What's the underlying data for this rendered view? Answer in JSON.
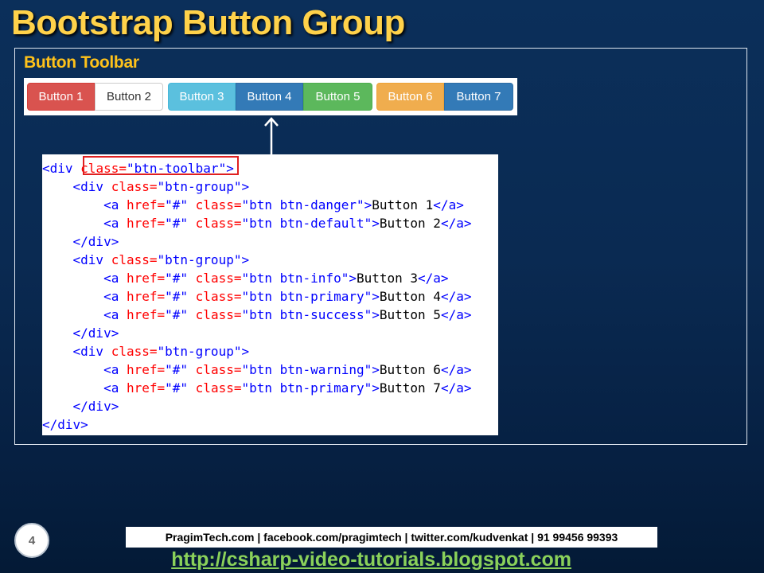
{
  "slide": {
    "title": "Bootstrap Button Group",
    "section_heading": "Button Toolbar",
    "page_number": "4"
  },
  "toolbar": {
    "groups": [
      [
        {
          "label": "Button 1",
          "style": "danger"
        },
        {
          "label": "Button 2",
          "style": "default"
        }
      ],
      [
        {
          "label": "Button 3",
          "style": "info"
        },
        {
          "label": "Button 4",
          "style": "primary"
        },
        {
          "label": "Button 5",
          "style": "success"
        }
      ],
      [
        {
          "label": "Button 6",
          "style": "warning"
        },
        {
          "label": "Button 7",
          "style": "primary"
        }
      ]
    ]
  },
  "code": {
    "lines": [
      [
        [
          "tag",
          "<div "
        ],
        [
          "attr",
          "class="
        ],
        [
          "val",
          "\"btn-toolbar\""
        ],
        [
          "tag",
          ">"
        ]
      ],
      [
        [
          "txt",
          "    "
        ],
        [
          "tag",
          "<div "
        ],
        [
          "attr",
          "class="
        ],
        [
          "val",
          "\"btn-group\""
        ],
        [
          "tag",
          ">"
        ]
      ],
      [
        [
          "txt",
          "        "
        ],
        [
          "tag",
          "<a "
        ],
        [
          "attr",
          "href="
        ],
        [
          "val",
          "\"#\" "
        ],
        [
          "attr",
          "class="
        ],
        [
          "val",
          "\"btn btn-danger\""
        ],
        [
          "tag",
          ">"
        ],
        [
          "txt",
          "Button 1"
        ],
        [
          "tag",
          "</a>"
        ]
      ],
      [
        [
          "txt",
          "        "
        ],
        [
          "tag",
          "<a "
        ],
        [
          "attr",
          "href="
        ],
        [
          "val",
          "\"#\" "
        ],
        [
          "attr",
          "class="
        ],
        [
          "val",
          "\"btn btn-default\""
        ],
        [
          "tag",
          ">"
        ],
        [
          "txt",
          "Button 2"
        ],
        [
          "tag",
          "</a>"
        ]
      ],
      [
        [
          "txt",
          "    "
        ],
        [
          "tag",
          "</div>"
        ]
      ],
      [
        [
          "txt",
          "    "
        ],
        [
          "tag",
          "<div "
        ],
        [
          "attr",
          "class="
        ],
        [
          "val",
          "\"btn-group\""
        ],
        [
          "tag",
          ">"
        ]
      ],
      [
        [
          "txt",
          "        "
        ],
        [
          "tag",
          "<a "
        ],
        [
          "attr",
          "href="
        ],
        [
          "val",
          "\"#\" "
        ],
        [
          "attr",
          "class="
        ],
        [
          "val",
          "\"btn btn-info\""
        ],
        [
          "tag",
          ">"
        ],
        [
          "txt",
          "Button 3"
        ],
        [
          "tag",
          "</a>"
        ]
      ],
      [
        [
          "txt",
          "        "
        ],
        [
          "tag",
          "<a "
        ],
        [
          "attr",
          "href="
        ],
        [
          "val",
          "\"#\" "
        ],
        [
          "attr",
          "class="
        ],
        [
          "val",
          "\"btn btn-primary\""
        ],
        [
          "tag",
          ">"
        ],
        [
          "txt",
          "Button 4"
        ],
        [
          "tag",
          "</a>"
        ]
      ],
      [
        [
          "txt",
          "        "
        ],
        [
          "tag",
          "<a "
        ],
        [
          "attr",
          "href="
        ],
        [
          "val",
          "\"#\" "
        ],
        [
          "attr",
          "class="
        ],
        [
          "val",
          "\"btn btn-success\""
        ],
        [
          "tag",
          ">"
        ],
        [
          "txt",
          "Button 5"
        ],
        [
          "tag",
          "</a>"
        ]
      ],
      [
        [
          "txt",
          "    "
        ],
        [
          "tag",
          "</div>"
        ]
      ],
      [
        [
          "txt",
          "    "
        ],
        [
          "tag",
          "<div "
        ],
        [
          "attr",
          "class="
        ],
        [
          "val",
          "\"btn-group\""
        ],
        [
          "tag",
          ">"
        ]
      ],
      [
        [
          "txt",
          "        "
        ],
        [
          "tag",
          "<a "
        ],
        [
          "attr",
          "href="
        ],
        [
          "val",
          "\"#\" "
        ],
        [
          "attr",
          "class="
        ],
        [
          "val",
          "\"btn btn-warning\""
        ],
        [
          "tag",
          ">"
        ],
        [
          "txt",
          "Button 6"
        ],
        [
          "tag",
          "</a>"
        ]
      ],
      [
        [
          "txt",
          "        "
        ],
        [
          "tag",
          "<a "
        ],
        [
          "attr",
          "href="
        ],
        [
          "val",
          "\"#\" "
        ],
        [
          "attr",
          "class="
        ],
        [
          "val",
          "\"btn btn-primary\""
        ],
        [
          "tag",
          ">"
        ],
        [
          "txt",
          "Button 7"
        ],
        [
          "tag",
          "</a>"
        ]
      ],
      [
        [
          "txt",
          "    "
        ],
        [
          "tag",
          "</div>"
        ]
      ],
      [
        [
          "tag",
          "</div>"
        ]
      ]
    ]
  },
  "footer": {
    "contact": "PragimTech.com | facebook.com/pragimtech  | twitter.com/kudvenkat  | 91 99456 99393",
    "url": "http://csharp-video-tutorials.blogspot.com"
  }
}
